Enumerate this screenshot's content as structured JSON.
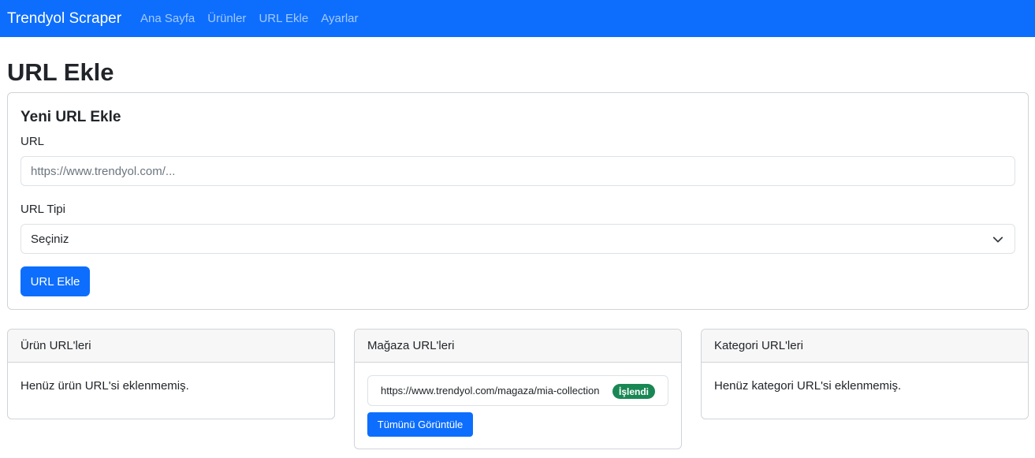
{
  "navbar": {
    "brand": "Trendyol Scraper",
    "links": [
      "Ana Sayfa",
      "Ürünler",
      "URL Ekle",
      "Ayarlar"
    ]
  },
  "page": {
    "title": "URL Ekle"
  },
  "form": {
    "title": "Yeni URL Ekle",
    "url_label": "URL",
    "url_placeholder": "https://www.trendyol.com/...",
    "url_value": "",
    "type_label": "URL Tipi",
    "type_selected": "Seçiniz",
    "submit_label": "URL Ekle"
  },
  "lists": {
    "products": {
      "header": "Ürün URL'leri",
      "empty": "Henüz ürün URL'si eklenmemiş."
    },
    "stores": {
      "header": "Mağaza URL'leri",
      "items": [
        {
          "url": "https://www.trendyol.com/magaza/mia-collection",
          "status": "İşlendi"
        }
      ],
      "view_all_label": "Tümünü Görüntüle"
    },
    "categories": {
      "header": "Kategori URL'leri",
      "empty": "Henüz kategori URL'si eklenmemiş."
    }
  },
  "colors": {
    "primary": "#0d6efd",
    "success": "#198754",
    "header_bg": "#f7f7f7"
  },
  "icons": {
    "select_chevron": "chevron-down-icon"
  }
}
